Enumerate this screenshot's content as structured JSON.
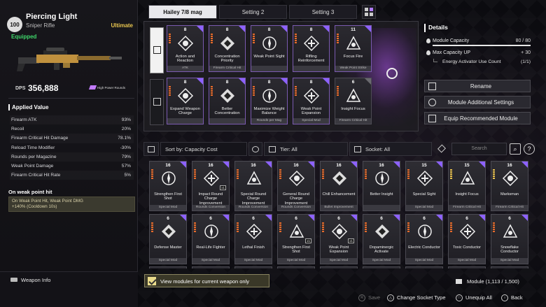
{
  "weapon": {
    "tier": "100",
    "name": "Piercing Light",
    "type": "Sniper Rifle",
    "rarity": "Ultimate",
    "status": "Equipped",
    "dps_label": "DPS",
    "dps_value": "356,888",
    "dps_tag": "High Power Rounds"
  },
  "applied_value": {
    "title": "Applied Value",
    "stats": [
      {
        "label": "Firearm ATK",
        "value": "93%"
      },
      {
        "label": "Recoil",
        "value": "20%"
      },
      {
        "label": "Firearm Critical Hit Damage",
        "value": "78.1%"
      },
      {
        "label": "Reload Time Modifier",
        "value": "-30%"
      },
      {
        "label": "Rounds per Magazine",
        "value": "79%"
      },
      {
        "label": "Weak Point Damage",
        "value": "57%"
      },
      {
        "label": "Firearm Critical Hit Rate",
        "value": "5%"
      }
    ]
  },
  "on_weak_point": {
    "title": "On weak point hit",
    "line1": "On Weak Point Hit, Weak Point DMG",
    "line2": "+140% (Cooldown 10s)"
  },
  "weapon_info_label": "Weapon Info",
  "tabs": [
    {
      "label": "Hailey 7/8 mag",
      "active": true
    },
    {
      "label": "Setting 2",
      "active": false
    },
    {
      "label": "Setting 3",
      "active": false
    }
  ],
  "equipped_modules": [
    {
      "cap": "8",
      "name": "Action and Reaction",
      "sub": "ATK",
      "rarity": "orange",
      "corner": "purple"
    },
    {
      "cap": "8",
      "name": "Concentration Priority",
      "sub": "Firearm Critical Hit",
      "rarity": "orange",
      "corner": "purple"
    },
    {
      "cap": "8",
      "name": "Weak Point Sight",
      "sub": "",
      "rarity": "orange",
      "corner": "purple"
    },
    {
      "cap": "8",
      "name": "Rifling Reinforcement",
      "sub": "",
      "rarity": "orange",
      "corner": "purple"
    },
    {
      "cap": "11",
      "name": "Focus Fire",
      "sub": "Weak Point Strike",
      "rarity": "orange",
      "corner": "purple"
    },
    {
      "cap": "8",
      "name": "Expand Weapon Charge",
      "sub": "",
      "rarity": "orange",
      "corner": "purple"
    },
    {
      "cap": "8",
      "name": "Better Concentration",
      "sub": "",
      "rarity": "orange",
      "corner": "purple"
    },
    {
      "cap": "8",
      "name": "Maximize Weight Balance",
      "sub": "Rounds per Mag",
      "rarity": "orange",
      "corner": "purple"
    },
    {
      "cap": "8",
      "name": "Weak Point Expansion",
      "sub": "Special Mod",
      "rarity": "orange",
      "corner": "purple"
    },
    {
      "cap": "6",
      "name": "Insight Focus",
      "sub": "Firearm Critical Hit",
      "rarity": "orange",
      "corner": "gray"
    }
  ],
  "details": {
    "title": "Details",
    "module_capacity_label": "Module Capacity",
    "module_capacity_value": "80 / 80",
    "module_capacity_fill": 1.0,
    "max_capacity_label": "Max Capacity UP",
    "max_capacity_value": "+ 30",
    "activator_label": "Energy Activator Use Count",
    "activator_value": "(1/1)"
  },
  "actions": {
    "rename": "Rename",
    "module_settings": "Module Additional Settings",
    "equip_recommended": "Equip Recommended Module"
  },
  "filters": {
    "sort": "Sort by: Capacity Cost",
    "tier": "Tier: All",
    "socket": "Socket: All",
    "search_placeholder": "Search"
  },
  "inventory": [
    {
      "cap": "16",
      "name": "Strengthen First Shot",
      "sub": "Special Mod",
      "rarity": "orange",
      "x1": ""
    },
    {
      "cap": "16",
      "name": "Impact Round Charge Improvement",
      "sub": "Rounds Conversion",
      "rarity": "orange",
      "x1": "x1"
    },
    {
      "cap": "16",
      "name": "Special Round Charge Improvement",
      "sub": "Rounds Conversion",
      "rarity": "orange",
      "x1": ""
    },
    {
      "cap": "16",
      "name": "General Round Charge Improvement",
      "sub": "Rounds Conversion",
      "rarity": "orange",
      "x1": ""
    },
    {
      "cap": "16",
      "name": "Chill Enhancement",
      "sub": "Bullet Improvement",
      "rarity": "orange",
      "x1": ""
    },
    {
      "cap": "16",
      "name": "Better Insight",
      "sub": "",
      "rarity": "orange",
      "x1": ""
    },
    {
      "cap": "15",
      "name": "Special Sight",
      "sub": "Special Mod",
      "rarity": "orange",
      "x1": ""
    },
    {
      "cap": "15",
      "name": "Insight Focus",
      "sub": "Firearm Critical Hit",
      "rarity": "gold",
      "x1": ""
    },
    {
      "cap": "16",
      "name": "Marksman",
      "sub": "Firearm Critical Hit",
      "rarity": "gold",
      "x1": ""
    },
    {
      "cap": "6",
      "name": "Defense Master",
      "sub": "Special Mod",
      "rarity": "orange",
      "x1": ""
    },
    {
      "cap": "6",
      "name": "Real-Life Fighter",
      "sub": "Special Mod",
      "rarity": "orange",
      "x1": ""
    },
    {
      "cap": "6",
      "name": "Lethal Finish",
      "sub": "Special Mod",
      "rarity": "orange",
      "x1": ""
    },
    {
      "cap": "6",
      "name": "Strengthen First Shot",
      "sub": "Special Mod",
      "rarity": "orange",
      "x1": "x1"
    },
    {
      "cap": "6",
      "name": "Weak Point Expansion",
      "sub": "Special Mod",
      "rarity": "orange",
      "x1": "x1"
    },
    {
      "cap": "6",
      "name": "Dopaminergic Activate",
      "sub": "Special Mod",
      "rarity": "orange",
      "x1": ""
    },
    {
      "cap": "6",
      "name": "Electric Conductor",
      "sub": "Special Mod",
      "rarity": "orange",
      "x1": ""
    },
    {
      "cap": "6",
      "name": "Toxic Conductor",
      "sub": "Special Mod",
      "rarity": "orange",
      "x1": ""
    },
    {
      "cap": "6",
      "name": "Snowflake Conductor",
      "sub": "Special Mod",
      "rarity": "orange",
      "x1": ""
    }
  ],
  "view_modules_label": "View modules for current weapon only",
  "module_count": "Module (1,113 / 1,500)",
  "hints": {
    "save": "Save",
    "change_socket": "Change Socket Type",
    "unequip_all": "Unequip All",
    "back": "Back"
  },
  "colors": {
    "accent_purple": "#8d62ff",
    "equipped_green": "#3fd86b",
    "ultimate_gold": "#e8c64e"
  }
}
